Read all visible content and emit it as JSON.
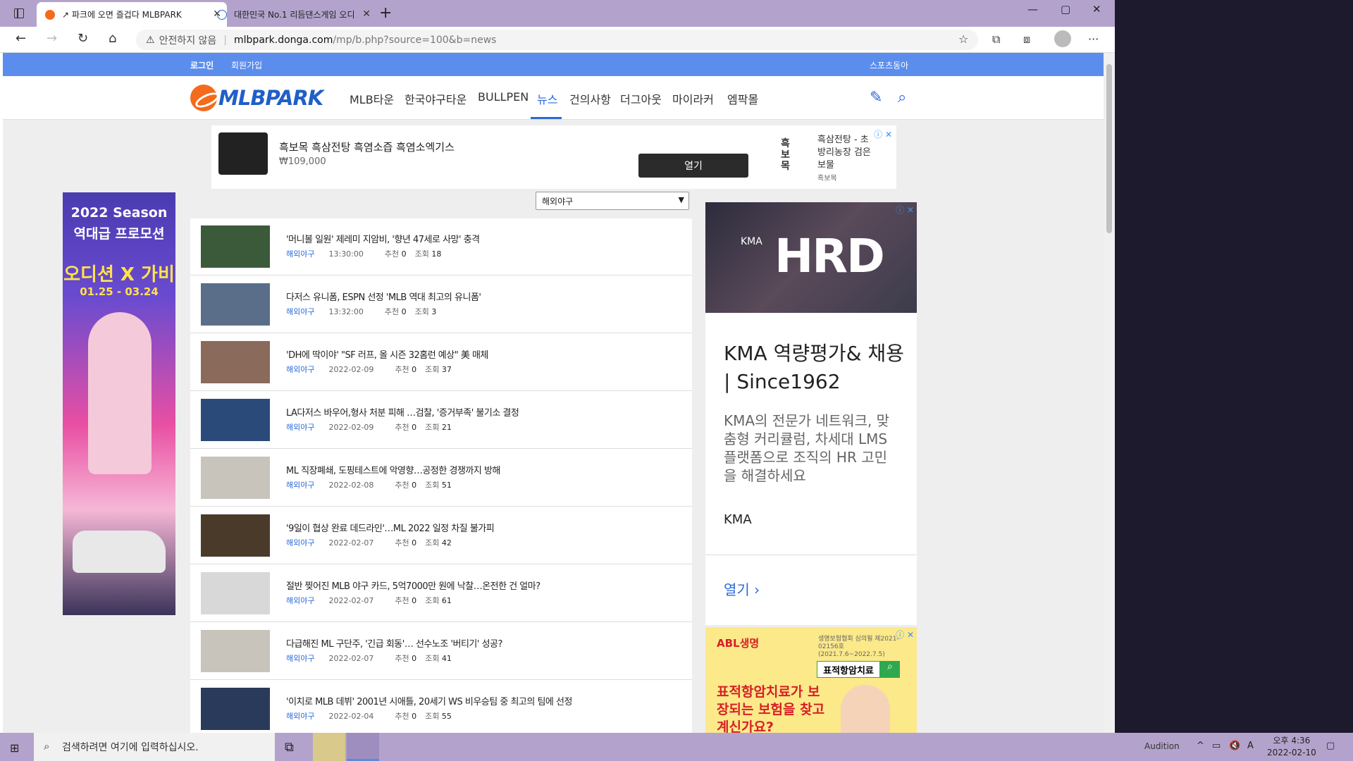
{
  "browser": {
    "tabs": [
      {
        "title": "↗ 파크에 오면 즐겁다 MLBPARK",
        "active": true
      },
      {
        "title": "대한민국 No.1 리듬댄스게임 오디",
        "active": false
      }
    ],
    "insecure_label": "안전하지 않음",
    "url_domain": "mlbpark.donga.com",
    "url_path": "/mp/b.php?source=100&b=news"
  },
  "site": {
    "login": "로그인",
    "join": "회원가입",
    "sports": "스포츠동아",
    "logo": "MLBPARK",
    "menu": [
      "MLB타운",
      "한국야구타운",
      "BULLPEN",
      "뉴스",
      "건의사항",
      "더그아웃",
      "마이라커",
      "엠팍몰"
    ],
    "active_menu": "뉴스"
  },
  "ad_top": {
    "title": "흑보목 흑삼전탕 흑염소즙 흑염소엑기스",
    "price": "₩109,000",
    "open": "열기",
    "brand": "흑보목",
    "right_text": "흑삼전탕 - 초방리농장 검은보물",
    "right_small": "흑보목"
  },
  "ad_left": {
    "line1": "2022 Season",
    "line2": "역대급 프로모션",
    "line3": "오디션 X 가비",
    "dates": "01.25 - 03.24"
  },
  "list": {
    "select": "해외야구",
    "items": [
      {
        "title": "'머니볼 일원' 제레미 지암비, '향년 47세로 사망' 충격",
        "cat": "해외야구",
        "date": "13:30:00",
        "rec_label": "추천",
        "rec": "0",
        "view_label": "조회",
        "views": "18"
      },
      {
        "title": "다저스 유니폼, ESPN 선정 'MLB 역대 최고의 유니폼'",
        "cat": "해외야구",
        "date": "13:32:00",
        "rec_label": "추천",
        "rec": "0",
        "view_label": "조회",
        "views": "3"
      },
      {
        "title": "'DH에 딱이야' \"SF 러프, 올 시즌 32홈런 예상\" 美 매체",
        "cat": "해외야구",
        "date": "2022-02-09",
        "rec_label": "추천",
        "rec": "0",
        "view_label": "조회",
        "views": "37"
      },
      {
        "title": "LA다저스 바우어,형사 처분 피해 …검찰, '증거부족' 불기소 결정",
        "cat": "해외야구",
        "date": "2022-02-09",
        "rec_label": "추천",
        "rec": "0",
        "view_label": "조회",
        "views": "21"
      },
      {
        "title": "ML 직장폐쇄, 도핑테스트에 악영향…공정한 경쟁까지 방해",
        "cat": "해외야구",
        "date": "2022-02-08",
        "rec_label": "추천",
        "rec": "0",
        "view_label": "조회",
        "views": "51"
      },
      {
        "title": "'9일이 협상 완료 데드라인'…ML 2022 일정 차질 불가피",
        "cat": "해외야구",
        "date": "2022-02-07",
        "rec_label": "추천",
        "rec": "0",
        "view_label": "조회",
        "views": "42"
      },
      {
        "title": "절반 찢어진 MLB 야구 카드, 5억7000만 원에 낙찰…온전한 건 얼마?",
        "cat": "해외야구",
        "date": "2022-02-07",
        "rec_label": "추천",
        "rec": "0",
        "view_label": "조회",
        "views": "61"
      },
      {
        "title": "다급해진 ML 구단주, '긴급 회동'… 선수노조 '버티기' 성공?",
        "cat": "해외야구",
        "date": "2022-02-07",
        "rec_label": "추천",
        "rec": "0",
        "view_label": "조회",
        "views": "41"
      },
      {
        "title": "'이치로 MLB 데뷔' 2001년 시애틀, 20세기 WS 비우승팀 중 최고의 팀에 선정",
        "cat": "해외야구",
        "date": "2022-02-04",
        "rec_label": "추천",
        "rec": "0",
        "view_label": "조회",
        "views": "55"
      }
    ]
  },
  "ad_right1": {
    "brand_small": "KMA",
    "brand_big": "HRD",
    "headline": "KMA 역량평가& 채용 | Since1962",
    "desc": "KMA의 전문가 네트워크, 맞춤형 커리큘럼, 차세대 LMS 플랫폼으로 조직의 HR 고민을 해결하세요",
    "advertiser": "KMA",
    "open": "열기"
  },
  "ad_right2": {
    "brand": "ABL생명",
    "notice": "생명보험협회 심의필 제2021-02156호(2021.7.6~2022.7.5)",
    "search": "표적항암치료",
    "headline": "표적항암치료가 보장되는 보험을 찾고 계신가요?"
  },
  "taskbar": {
    "search_placeholder": "검색하려면 여기에 입력하십시오.",
    "tray_app": "Audition",
    "time": "오후 4:36",
    "date": "2022-02-10"
  },
  "colors": {
    "accent": "#2a6ad9",
    "topbar": "#5b8ded",
    "taskbar": "#b3a3cc"
  }
}
